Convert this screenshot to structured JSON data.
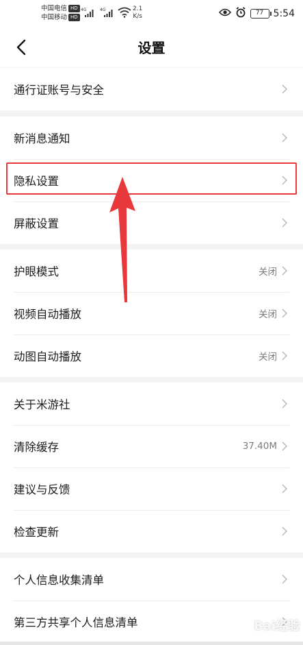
{
  "status_bar": {
    "carrier_1": "中国电信",
    "carrier_2": "中国移动",
    "hd_badge": "HD",
    "net_type_1": "4G",
    "net_type_2": "4G",
    "speed_value": "2.1",
    "speed_unit": "K/s",
    "battery": "77",
    "time": "5:54",
    "icons": [
      "eye-icon",
      "alarm-icon",
      "wifi-icon",
      "signal-icon",
      "battery-icon"
    ]
  },
  "header": {
    "title": "设置",
    "back_icon": "chevron-left-icon"
  },
  "sections": [
    {
      "items": [
        {
          "label": "通行证账号与安全",
          "value": ""
        }
      ]
    },
    {
      "items": [
        {
          "label": "新消息通知",
          "value": ""
        },
        {
          "label": "隐私设置",
          "value": ""
        },
        {
          "label": "屏蔽设置",
          "value": ""
        }
      ]
    },
    {
      "items": [
        {
          "label": "护眼模式",
          "value": "关闭"
        },
        {
          "label": "视频自动播放",
          "value": "关闭"
        },
        {
          "label": "动图自动播放",
          "value": "关闭"
        }
      ]
    },
    {
      "items": [
        {
          "label": "关于米游社",
          "value": ""
        },
        {
          "label": "清除缓存",
          "value": "37.40M"
        },
        {
          "label": "建议与反馈",
          "value": ""
        },
        {
          "label": "检查更新",
          "value": ""
        }
      ]
    },
    {
      "items": [
        {
          "label": "个人信息收集清单",
          "value": ""
        },
        {
          "label": "第三方共享个人信息清单",
          "value": ""
        }
      ]
    }
  ],
  "annotation": {
    "color": "#e8383b",
    "highlighted_item": "隐私设置"
  },
  "watermark": {
    "text": "Bai经验"
  }
}
